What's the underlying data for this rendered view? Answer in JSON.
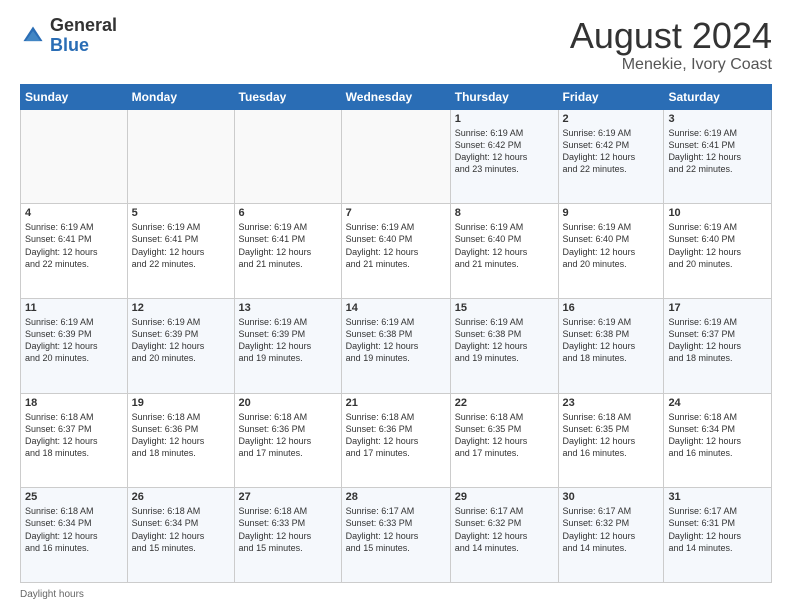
{
  "logo": {
    "general": "General",
    "blue": "Blue"
  },
  "title": "August 2024",
  "subtitle": "Menekie, Ivory Coast",
  "footer": "Daylight hours",
  "days_of_week": [
    "Sunday",
    "Monday",
    "Tuesday",
    "Wednesday",
    "Thursday",
    "Friday",
    "Saturday"
  ],
  "weeks": [
    [
      {
        "day": "",
        "info": ""
      },
      {
        "day": "",
        "info": ""
      },
      {
        "day": "",
        "info": ""
      },
      {
        "day": "",
        "info": ""
      },
      {
        "day": "1",
        "info": "Sunrise: 6:19 AM\nSunset: 6:42 PM\nDaylight: 12 hours\nand 23 minutes."
      },
      {
        "day": "2",
        "info": "Sunrise: 6:19 AM\nSunset: 6:42 PM\nDaylight: 12 hours\nand 22 minutes."
      },
      {
        "day": "3",
        "info": "Sunrise: 6:19 AM\nSunset: 6:41 PM\nDaylight: 12 hours\nand 22 minutes."
      }
    ],
    [
      {
        "day": "4",
        "info": "Sunrise: 6:19 AM\nSunset: 6:41 PM\nDaylight: 12 hours\nand 22 minutes."
      },
      {
        "day": "5",
        "info": "Sunrise: 6:19 AM\nSunset: 6:41 PM\nDaylight: 12 hours\nand 22 minutes."
      },
      {
        "day": "6",
        "info": "Sunrise: 6:19 AM\nSunset: 6:41 PM\nDaylight: 12 hours\nand 21 minutes."
      },
      {
        "day": "7",
        "info": "Sunrise: 6:19 AM\nSunset: 6:40 PM\nDaylight: 12 hours\nand 21 minutes."
      },
      {
        "day": "8",
        "info": "Sunrise: 6:19 AM\nSunset: 6:40 PM\nDaylight: 12 hours\nand 21 minutes."
      },
      {
        "day": "9",
        "info": "Sunrise: 6:19 AM\nSunset: 6:40 PM\nDaylight: 12 hours\nand 20 minutes."
      },
      {
        "day": "10",
        "info": "Sunrise: 6:19 AM\nSunset: 6:40 PM\nDaylight: 12 hours\nand 20 minutes."
      }
    ],
    [
      {
        "day": "11",
        "info": "Sunrise: 6:19 AM\nSunset: 6:39 PM\nDaylight: 12 hours\nand 20 minutes."
      },
      {
        "day": "12",
        "info": "Sunrise: 6:19 AM\nSunset: 6:39 PM\nDaylight: 12 hours\nand 20 minutes."
      },
      {
        "day": "13",
        "info": "Sunrise: 6:19 AM\nSunset: 6:39 PM\nDaylight: 12 hours\nand 19 minutes."
      },
      {
        "day": "14",
        "info": "Sunrise: 6:19 AM\nSunset: 6:38 PM\nDaylight: 12 hours\nand 19 minutes."
      },
      {
        "day": "15",
        "info": "Sunrise: 6:19 AM\nSunset: 6:38 PM\nDaylight: 12 hours\nand 19 minutes."
      },
      {
        "day": "16",
        "info": "Sunrise: 6:19 AM\nSunset: 6:38 PM\nDaylight: 12 hours\nand 18 minutes."
      },
      {
        "day": "17",
        "info": "Sunrise: 6:19 AM\nSunset: 6:37 PM\nDaylight: 12 hours\nand 18 minutes."
      }
    ],
    [
      {
        "day": "18",
        "info": "Sunrise: 6:18 AM\nSunset: 6:37 PM\nDaylight: 12 hours\nand 18 minutes."
      },
      {
        "day": "19",
        "info": "Sunrise: 6:18 AM\nSunset: 6:36 PM\nDaylight: 12 hours\nand 18 minutes."
      },
      {
        "day": "20",
        "info": "Sunrise: 6:18 AM\nSunset: 6:36 PM\nDaylight: 12 hours\nand 17 minutes."
      },
      {
        "day": "21",
        "info": "Sunrise: 6:18 AM\nSunset: 6:36 PM\nDaylight: 12 hours\nand 17 minutes."
      },
      {
        "day": "22",
        "info": "Sunrise: 6:18 AM\nSunset: 6:35 PM\nDaylight: 12 hours\nand 17 minutes."
      },
      {
        "day": "23",
        "info": "Sunrise: 6:18 AM\nSunset: 6:35 PM\nDaylight: 12 hours\nand 16 minutes."
      },
      {
        "day": "24",
        "info": "Sunrise: 6:18 AM\nSunset: 6:34 PM\nDaylight: 12 hours\nand 16 minutes."
      }
    ],
    [
      {
        "day": "25",
        "info": "Sunrise: 6:18 AM\nSunset: 6:34 PM\nDaylight: 12 hours\nand 16 minutes."
      },
      {
        "day": "26",
        "info": "Sunrise: 6:18 AM\nSunset: 6:34 PM\nDaylight: 12 hours\nand 15 minutes."
      },
      {
        "day": "27",
        "info": "Sunrise: 6:18 AM\nSunset: 6:33 PM\nDaylight: 12 hours\nand 15 minutes."
      },
      {
        "day": "28",
        "info": "Sunrise: 6:17 AM\nSunset: 6:33 PM\nDaylight: 12 hours\nand 15 minutes."
      },
      {
        "day": "29",
        "info": "Sunrise: 6:17 AM\nSunset: 6:32 PM\nDaylight: 12 hours\nand 14 minutes."
      },
      {
        "day": "30",
        "info": "Sunrise: 6:17 AM\nSunset: 6:32 PM\nDaylight: 12 hours\nand 14 minutes."
      },
      {
        "day": "31",
        "info": "Sunrise: 6:17 AM\nSunset: 6:31 PM\nDaylight: 12 hours\nand 14 minutes."
      }
    ]
  ]
}
